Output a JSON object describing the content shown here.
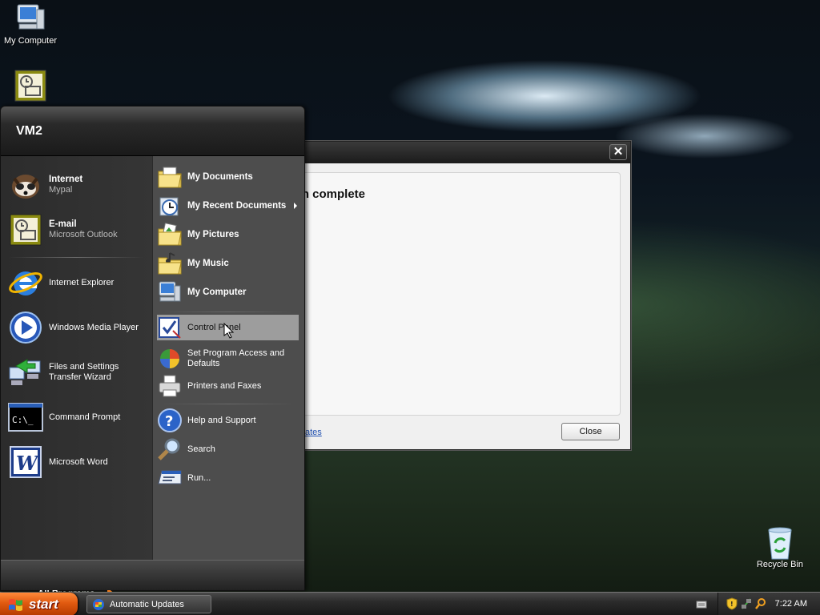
{
  "desktop": {
    "icons": [
      {
        "label": "My Computer",
        "icon": "computer-icon"
      },
      {
        "label": "",
        "icon": "outlook-icon"
      },
      {
        "label": "Recycle Bin",
        "icon": "recycle-bin-icon"
      }
    ]
  },
  "dialog": {
    "heading": "n complete",
    "link_text": "ates",
    "close_button": "Close",
    "title_close_glyph": "✕"
  },
  "start_menu": {
    "user_name": "VM2",
    "pinned": [
      {
        "title": "Internet",
        "subtitle": "Mypal",
        "icon": "mypal-browser-icon"
      },
      {
        "title": "E-mail",
        "subtitle": "Microsoft Outlook",
        "icon": "outlook-icon"
      }
    ],
    "recent": [
      {
        "label": "Internet Explorer",
        "icon": "internet-explorer-icon"
      },
      {
        "label": "Windows Media Player",
        "icon": "media-player-icon"
      },
      {
        "label": "Files and Settings\nTransfer Wizard",
        "line1": "Files and Settings",
        "line2": "Transfer Wizard",
        "icon": "transfer-wizard-icon"
      },
      {
        "label": "Command Prompt",
        "icon": "command-prompt-icon"
      },
      {
        "label": "Microsoft Word",
        "icon": "word-icon"
      }
    ],
    "all_programs": "All Programs",
    "right": [
      {
        "label": "My Documents",
        "icon": "documents-folder-icon"
      },
      {
        "label": "My Recent Documents",
        "icon": "recent-documents-icon"
      },
      {
        "label": "My Pictures",
        "icon": "pictures-folder-icon"
      },
      {
        "label": "My Music",
        "icon": "music-folder-icon"
      },
      {
        "label": "My Computer",
        "icon": "computer-icon"
      },
      {
        "label": "Control Panel",
        "icon": "control-panel-icon"
      },
      {
        "label": "Set Program Access and Defaults",
        "line1": "Set Program Access and",
        "line2": "Defaults",
        "icon": "program-access-icon"
      },
      {
        "label": "Printers and Faxes",
        "icon": "printer-icon"
      },
      {
        "label": "Help and Support",
        "icon": "help-icon"
      },
      {
        "label": "Search",
        "icon": "search-icon"
      },
      {
        "label": "Run...",
        "icon": "run-icon"
      }
    ]
  },
  "taskbar": {
    "start_label": "start",
    "tasks": [
      {
        "label": "Automatic Updates",
        "icon": "windows-update-icon"
      }
    ],
    "clock": "7:22 AM",
    "tray_icons": [
      "keyboard-icon",
      "security-shield-icon",
      "network-icon",
      "search-icon"
    ]
  },
  "colors": {
    "start_button": "#e05a10",
    "menu_bg": "#3b3b3b",
    "hover": "#9d9d9d",
    "link": "#1f4fb0"
  }
}
